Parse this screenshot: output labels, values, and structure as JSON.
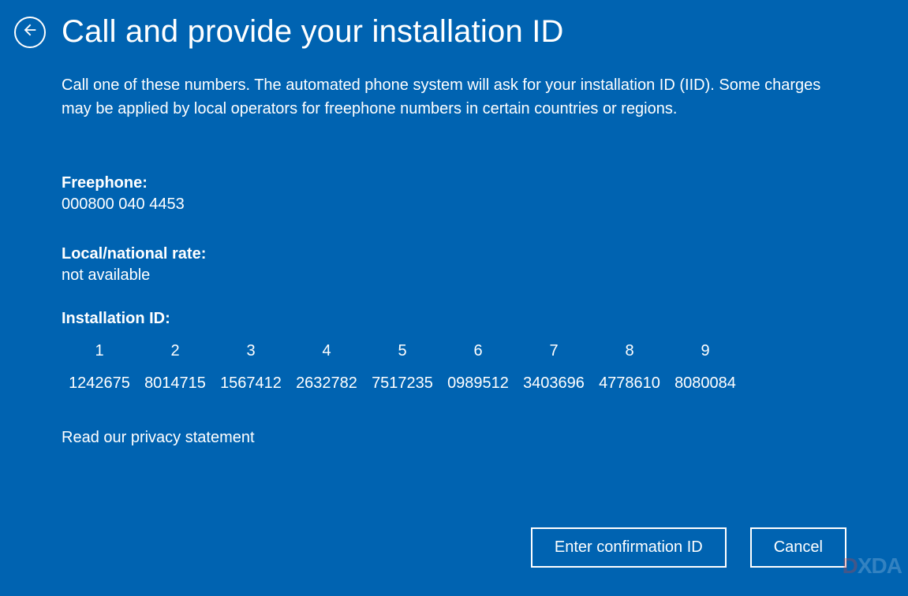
{
  "header": {
    "title": "Call and provide your installation ID"
  },
  "description": "Call one of these numbers. The automated phone system will ask for your installation ID (IID). Some charges may be applied by local operators for freephone numbers in certain countries or regions.",
  "freephone": {
    "label": "Freephone:",
    "value": "000800 040 4453"
  },
  "local_rate": {
    "label": "Local/national rate:",
    "value": "not available"
  },
  "installation_id": {
    "label": "Installation ID:",
    "columns": [
      "1",
      "2",
      "3",
      "4",
      "5",
      "6",
      "7",
      "8",
      "9"
    ],
    "groups": [
      "1242675",
      "8014715",
      "1567412",
      "2632782",
      "7517235",
      "0989512",
      "3403696",
      "4778610",
      "8080084"
    ]
  },
  "privacy_link": "Read our privacy statement",
  "buttons": {
    "enter_confirmation": "Enter confirmation ID",
    "cancel": "Cancel"
  },
  "watermark": {
    "part1": "D",
    "part2": "XDA"
  }
}
